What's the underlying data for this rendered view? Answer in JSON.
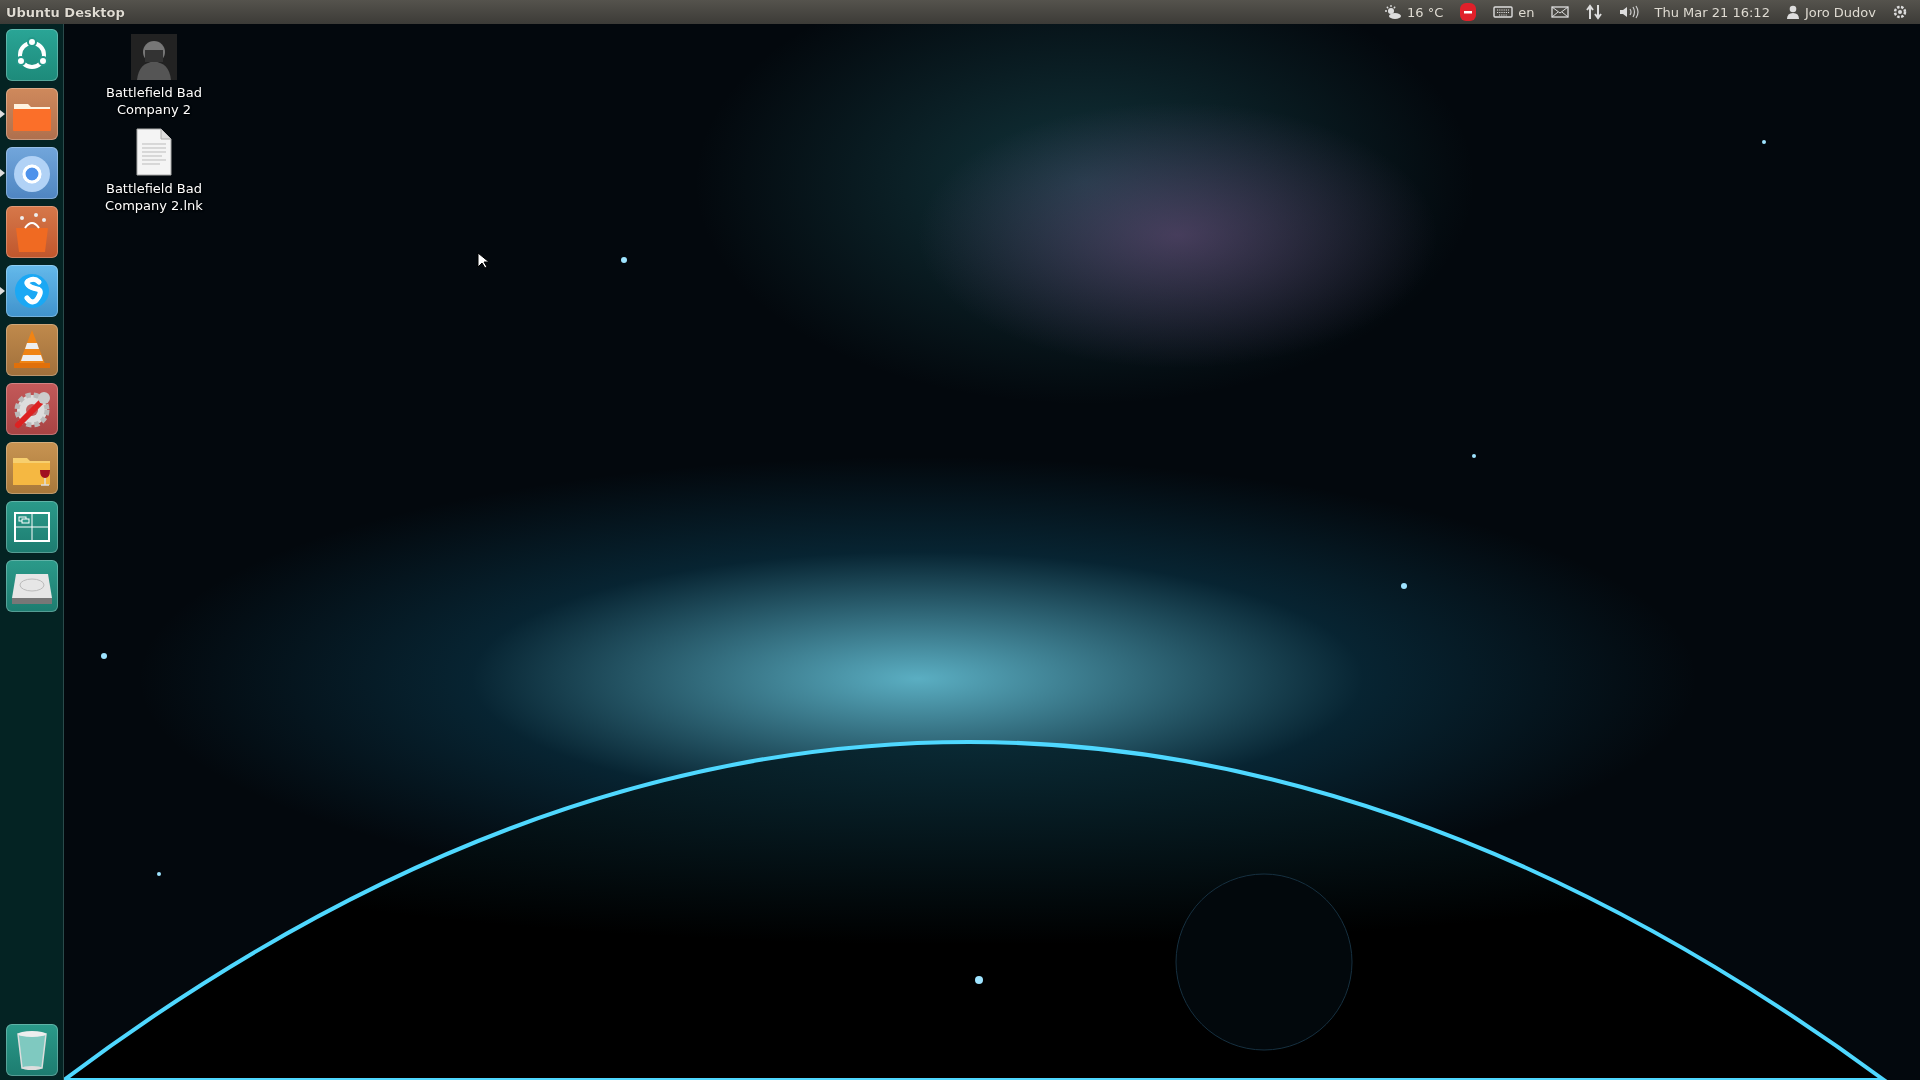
{
  "panel": {
    "title": "Ubuntu Desktop",
    "indicators": [
      {
        "kind": "weather",
        "text": "16 °C"
      },
      {
        "kind": "status"
      },
      {
        "kind": "keyboard",
        "text": "en"
      },
      {
        "kind": "mail"
      },
      {
        "kind": "network"
      },
      {
        "kind": "sound"
      },
      {
        "kind": "clock",
        "text": "Thu Mar 21 16:12"
      },
      {
        "kind": "user",
        "text": "Joro Dudov"
      },
      {
        "kind": "session"
      }
    ]
  },
  "launcher": {
    "items": [
      {
        "kind": "dash",
        "running": false
      },
      {
        "kind": "files",
        "running": true
      },
      {
        "kind": "browser",
        "running": true
      },
      {
        "kind": "store",
        "running": false
      },
      {
        "kind": "chat",
        "running": true
      },
      {
        "kind": "media",
        "running": false
      },
      {
        "kind": "tools",
        "running": false
      },
      {
        "kind": "wine",
        "running": false
      },
      {
        "kind": "workspaces",
        "running": false
      },
      {
        "kind": "drive",
        "running": false
      }
    ],
    "trash": {
      "kind": "trash"
    }
  },
  "desktop": {
    "icons": [
      {
        "kind": "game",
        "label": "Battlefield Bad Company 2"
      },
      {
        "kind": "document",
        "label": "Battlefield Bad Company 2.lnk"
      }
    ]
  }
}
